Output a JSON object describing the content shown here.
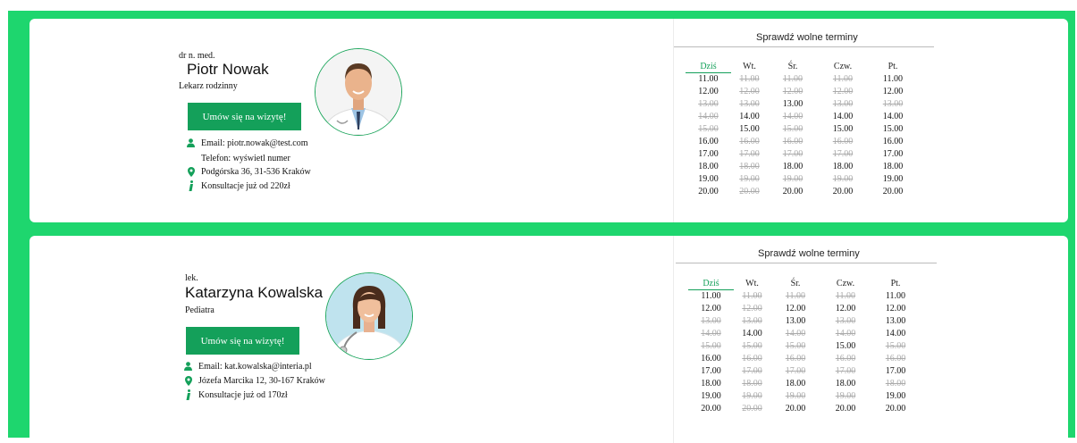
{
  "schedule_title": "Sprawdź wolne terminy",
  "days": [
    "Dziś",
    "Wt.",
    "Śr.",
    "Czw.",
    "Pt."
  ],
  "colors": {
    "accent": "#14a05a",
    "frame": "#1ed66e",
    "taken": "#aaaaaa"
  },
  "doctors": [
    {
      "title": "dr n. med.",
      "name": "Piotr Nowak",
      "specialty": "Lekarz rodzinny",
      "button": "Umów się na wizytę!",
      "email": "Email: piotr.nowak@test.com",
      "phone": "Telefon: wyświetl numer",
      "address": "Podgórska 36, 31-536 Kraków",
      "price": "Konsultacje już od 220zł",
      "avatar_icon": "doctor-male-portrait",
      "slots": [
        [
          {
            "t": "11.00",
            "a": true
          },
          {
            "t": "11.00",
            "a": false
          },
          {
            "t": "11.00",
            "a": false
          },
          {
            "t": "11.00",
            "a": false
          },
          {
            "t": "11.00",
            "a": true
          }
        ],
        [
          {
            "t": "12.00",
            "a": true
          },
          {
            "t": "12.00",
            "a": false
          },
          {
            "t": "12.00",
            "a": false
          },
          {
            "t": "12.00",
            "a": false
          },
          {
            "t": "12.00",
            "a": true
          }
        ],
        [
          {
            "t": "13.00",
            "a": false
          },
          {
            "t": "13.00",
            "a": false
          },
          {
            "t": "13.00",
            "a": true
          },
          {
            "t": "13.00",
            "a": false
          },
          {
            "t": "13.00",
            "a": false
          }
        ],
        [
          {
            "t": "14.00",
            "a": false
          },
          {
            "t": "14.00",
            "a": true
          },
          {
            "t": "14.00",
            "a": false
          },
          {
            "t": "14.00",
            "a": true
          },
          {
            "t": "14.00",
            "a": true
          }
        ],
        [
          {
            "t": "15.00",
            "a": false
          },
          {
            "t": "15.00",
            "a": true
          },
          {
            "t": "15.00",
            "a": false
          },
          {
            "t": "15.00",
            "a": true
          },
          {
            "t": "15.00",
            "a": true
          }
        ],
        [
          {
            "t": "16.00",
            "a": true
          },
          {
            "t": "16.00",
            "a": false
          },
          {
            "t": "16.00",
            "a": false
          },
          {
            "t": "16.00",
            "a": false
          },
          {
            "t": "16.00",
            "a": true
          }
        ],
        [
          {
            "t": "17.00",
            "a": true
          },
          {
            "t": "17.00",
            "a": false
          },
          {
            "t": "17.00",
            "a": false
          },
          {
            "t": "17.00",
            "a": false
          },
          {
            "t": "17.00",
            "a": true
          }
        ],
        [
          {
            "t": "18.00",
            "a": true
          },
          {
            "t": "18.00",
            "a": false
          },
          {
            "t": "18.00",
            "a": true
          },
          {
            "t": "18.00",
            "a": true
          },
          {
            "t": "18.00",
            "a": true
          }
        ],
        [
          {
            "t": "19.00",
            "a": true
          },
          {
            "t": "19.00",
            "a": false
          },
          {
            "t": "19.00",
            "a": false
          },
          {
            "t": "19.00",
            "a": false
          },
          {
            "t": "19.00",
            "a": true
          }
        ],
        [
          {
            "t": "20.00",
            "a": true
          },
          {
            "t": "20.00",
            "a": false
          },
          {
            "t": "20.00",
            "a": true
          },
          {
            "t": "20.00",
            "a": true
          },
          {
            "t": "20.00",
            "a": true
          }
        ]
      ]
    },
    {
      "title": "lek.",
      "name": "Katarzyna Kowalska",
      "specialty": "Pediatra",
      "button": "Umów się na wizytę!",
      "email": "Email: kat.kowalska@interia.pl",
      "address": "Józefa Marcika 12, 30-167 Kraków",
      "price": "Konsultacje już od 170zł",
      "avatar_icon": "doctor-female-portrait",
      "slots": [
        [
          {
            "t": "11.00",
            "a": true
          },
          {
            "t": "11.00",
            "a": false
          },
          {
            "t": "11.00",
            "a": false
          },
          {
            "t": "11.00",
            "a": false
          },
          {
            "t": "11.00",
            "a": true
          }
        ],
        [
          {
            "t": "12.00",
            "a": true
          },
          {
            "t": "12.00",
            "a": false
          },
          {
            "t": "12.00",
            "a": true
          },
          {
            "t": "12.00",
            "a": true
          },
          {
            "t": "12.00",
            "a": true
          }
        ],
        [
          {
            "t": "13.00",
            "a": false
          },
          {
            "t": "13.00",
            "a": false
          },
          {
            "t": "13.00",
            "a": true
          },
          {
            "t": "13.00",
            "a": false
          },
          {
            "t": "13.00",
            "a": true
          }
        ],
        [
          {
            "t": "14.00",
            "a": false
          },
          {
            "t": "14.00",
            "a": true
          },
          {
            "t": "14.00",
            "a": false
          },
          {
            "t": "14.00",
            "a": false
          },
          {
            "t": "14.00",
            "a": true
          }
        ],
        [
          {
            "t": "15.00",
            "a": false
          },
          {
            "t": "15.00",
            "a": false
          },
          {
            "t": "15.00",
            "a": false
          },
          {
            "t": "15.00",
            "a": true
          },
          {
            "t": "15.00",
            "a": false
          }
        ],
        [
          {
            "t": "16.00",
            "a": true
          },
          {
            "t": "16.00",
            "a": false
          },
          {
            "t": "16.00",
            "a": false
          },
          {
            "t": "16.00",
            "a": false
          },
          {
            "t": "16.00",
            "a": false
          }
        ],
        [
          {
            "t": "17.00",
            "a": true
          },
          {
            "t": "17.00",
            "a": false
          },
          {
            "t": "17.00",
            "a": false
          },
          {
            "t": "17.00",
            "a": false
          },
          {
            "t": "17.00",
            "a": true
          }
        ],
        [
          {
            "t": "18.00",
            "a": true
          },
          {
            "t": "18.00",
            "a": false
          },
          {
            "t": "18.00",
            "a": true
          },
          {
            "t": "18.00",
            "a": true
          },
          {
            "t": "18.00",
            "a": false
          }
        ],
        [
          {
            "t": "19.00",
            "a": true
          },
          {
            "t": "19.00",
            "a": false
          },
          {
            "t": "19.00",
            "a": false
          },
          {
            "t": "19.00",
            "a": false
          },
          {
            "t": "19.00",
            "a": true
          }
        ],
        [
          {
            "t": "20.00",
            "a": true
          },
          {
            "t": "20.00",
            "a": false
          },
          {
            "t": "20.00",
            "a": true
          },
          {
            "t": "20.00",
            "a": true
          },
          {
            "t": "20.00",
            "a": true
          }
        ]
      ]
    }
  ]
}
